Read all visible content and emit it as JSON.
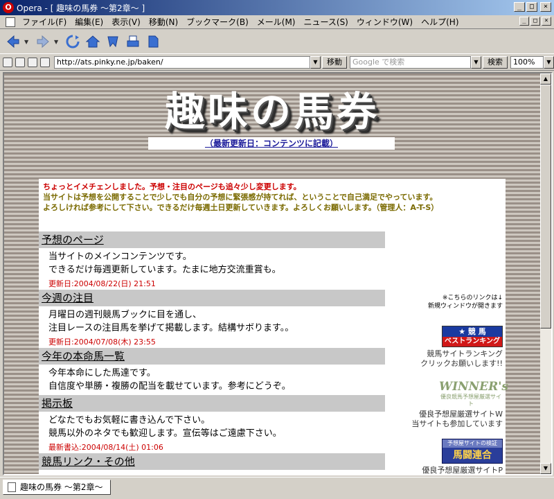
{
  "window": {
    "app": "Opera",
    "title": "Opera - [ 趣味の馬券 〜第2章〜 ]",
    "minimize": "_",
    "maximize": "□",
    "close": "×"
  },
  "menu": {
    "items": [
      "ファイル(F)",
      "編集(E)",
      "表示(V)",
      "移動(N)",
      "ブックマーク(B)",
      "メール(M)",
      "ニュース(S)",
      "ウィンドウ(W)",
      "ヘルプ(H)"
    ]
  },
  "address_bar": {
    "url": "http://ats.pinky.ne.jp/baken/",
    "go_label": "移動",
    "search_placeholder": "Google で検索",
    "search_label": "検索",
    "zoom": "100%"
  },
  "page": {
    "site_title": "趣味の馬券",
    "update_link": "（最新更新日：コンテンツに記載）",
    "notice_red": "ちょっとイメチェンしました。予想・注目のページも追々少し変更します。",
    "notice_olive_1": "当サイトは予想を公開することで少しでも自分の予想に緊張感が持てれば、ということで自己満足でやっています。",
    "notice_olive_2": "よろしければ参考にして下さい。できるだけ毎週土日更新していきます。よろしくお願いします。（管理人：A-T-S）",
    "sections": [
      {
        "title": "予想のページ",
        "line1": "当サイトのメインコンテンツです。",
        "line2": "できるだけ毎週更新しています。たまに地方交流重賞も。",
        "date": "更新日:2004/08/22(日) 21:51"
      },
      {
        "title": "今週の注目",
        "line1": "月曜日の週刊競馬ブックに目を通し、",
        "line2": "注目レースの注目馬を挙げて掲載します。結構サボります。。",
        "date": "更新日:2004/07/08(木) 23:55"
      },
      {
        "title": "今年の本命馬一覧",
        "line1": "今年本命にした馬達です。",
        "line2": "自信度や単勝・複勝の配当を載せています。参考にどうぞ。",
        "date": ""
      },
      {
        "title": "掲示板",
        "line1": "どなたでもお気軽に書き込んで下さい。",
        "line2": "競馬以外のネタでも歓迎します。宣伝等はご遠慮下さい。",
        "date": "最新書込:2004/08/14(土) 01:06"
      },
      {
        "title": "競馬リンク・その他",
        "line1": "",
        "line2": "",
        "date": ""
      }
    ],
    "right_note_1": "※こちらのリンクは↓",
    "right_note_2": "新規ウィンドウが開きます",
    "banner_ranking_top": "★ 競 馬",
    "banner_ranking_bottom": "ベストランキング",
    "ranking_caption_1": "競馬サイトランキング",
    "ranking_caption_2": "クリックお願いします!!",
    "banner_winners_main": "WINNER's",
    "banner_winners_sub": "優良競馬予想屋厳選サイト",
    "winners_caption_1": "優良予想屋厳選サイトW",
    "winners_caption_2": "当サイトも参加しています",
    "banner_tokken_top": "予想屋サイトの検証",
    "banner_tokken_main": "馬闘連合",
    "tokken_caption": "優良予想屋厳選サイトP"
  },
  "tab": {
    "label": "趣味の馬券 〜第2章〜"
  },
  "colors": {
    "notice_red": "#cc0000",
    "notice_olive": "#7a6a00",
    "link_blue": "#1a1a9a",
    "stripe_dark": "#9a9088",
    "stripe_light": "#cdc7bf"
  }
}
